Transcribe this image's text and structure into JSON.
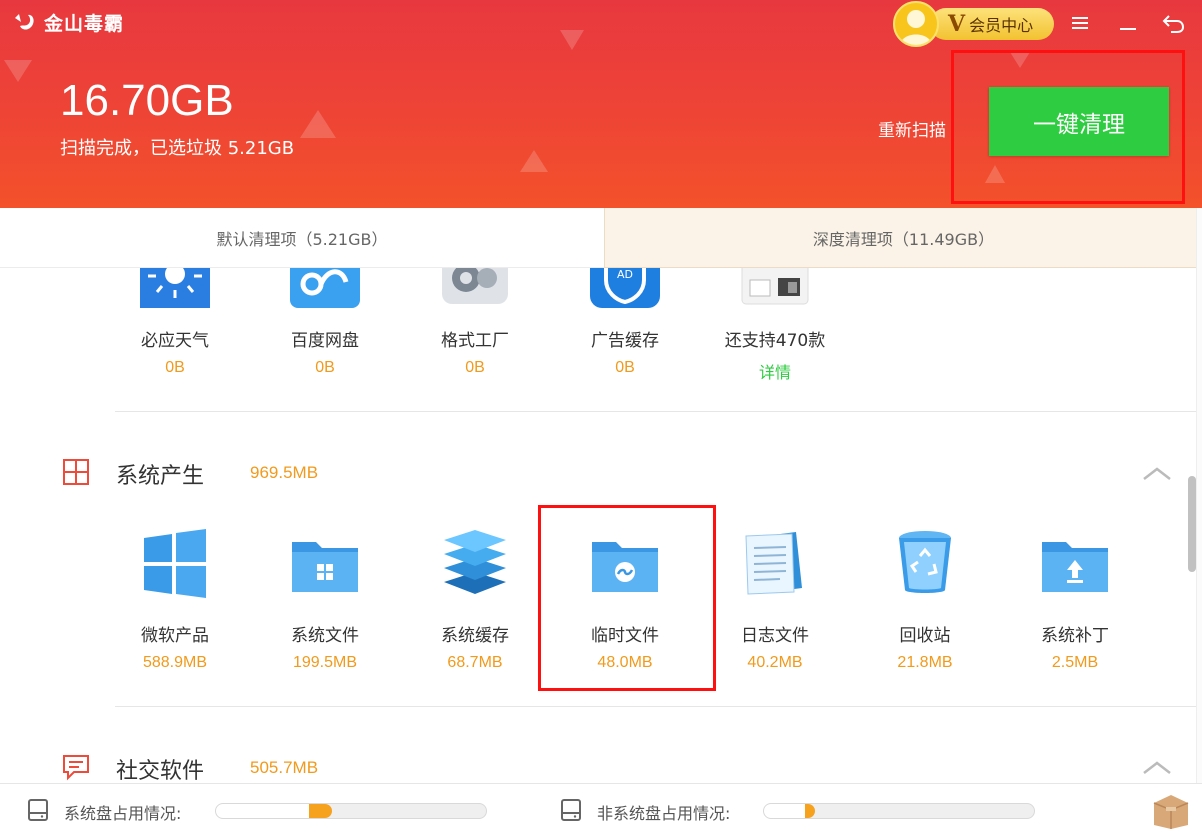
{
  "app": {
    "title": "金山毒霸"
  },
  "header": {
    "vip_label": "会员中心",
    "vip_badge": "V",
    "total_size": "16.70GB",
    "status": "扫描完成，已选垃圾 5.21GB",
    "rescan": "重新扫描",
    "clean_button": "一键清理"
  },
  "tabs": [
    {
      "label": "默认清理项（5.21GB）",
      "active": true
    },
    {
      "label": "深度清理项（11.49GB）",
      "active": false
    }
  ],
  "software_items": [
    {
      "label": "必应天气",
      "size": "0B",
      "icon": "weather-app-icon"
    },
    {
      "label": "百度网盘",
      "size": "0B",
      "icon": "cloud-drive-icon"
    },
    {
      "label": "格式工厂",
      "size": "0B",
      "icon": "format-factory-icon"
    },
    {
      "label": "广告缓存",
      "size": "0B",
      "icon": "ad-shield-icon"
    },
    {
      "label": "还支持470款",
      "size": "详情",
      "icon": "more-apps-icon"
    }
  ],
  "sections": [
    {
      "title": "系统产生",
      "size": "969.5MB",
      "items": [
        {
          "label": "微软产品",
          "size": "588.9MB",
          "icon": "windows-logo-icon"
        },
        {
          "label": "系统文件",
          "size": "199.5MB",
          "icon": "system-folder-icon"
        },
        {
          "label": "系统缓存",
          "size": "68.7MB",
          "icon": "stacked-layers-icon"
        },
        {
          "label": "临时文件",
          "size": "48.0MB",
          "icon": "temp-folder-icon"
        },
        {
          "label": "日志文件",
          "size": "40.2MB",
          "icon": "log-document-icon"
        },
        {
          "label": "回收站",
          "size": "21.8MB",
          "icon": "recycle-bin-icon"
        },
        {
          "label": "系统补丁",
          "size": "2.5MB",
          "icon": "patch-folder-icon"
        }
      ]
    },
    {
      "title": "社交软件",
      "size": "505.7MB"
    }
  ],
  "footer": {
    "system_disk_label": "系统盘占用情况:",
    "non_system_disk_label": "非系统盘占用情况:",
    "system_disk_usage": 0.43,
    "non_system_disk_usage": 0.19
  },
  "colors": {
    "header_red": "#ee4436",
    "accent_green": "#2ecc40",
    "size_orange": "#f19a1c",
    "highlight_red": "#ff1010"
  }
}
